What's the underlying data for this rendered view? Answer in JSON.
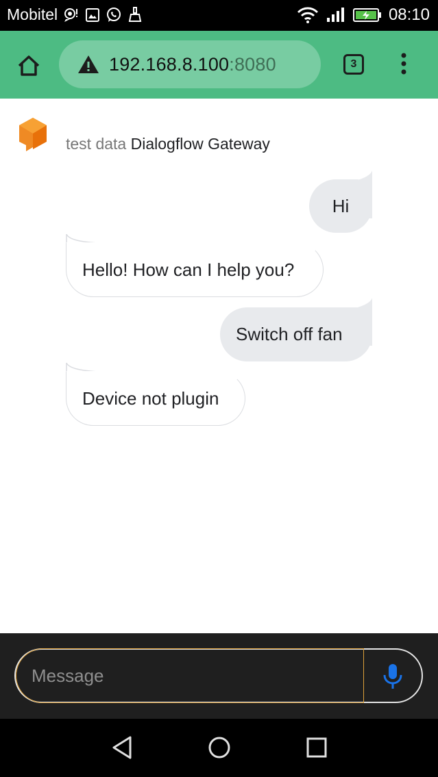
{
  "status_bar": {
    "carrier": "Mobitel",
    "time": "08:10",
    "icons": [
      "notification-icon",
      "gallery-icon",
      "whatsapp-icon",
      "clean-icon",
      "wifi-icon",
      "signal-icon",
      "battery-charging-icon"
    ]
  },
  "browser": {
    "url_host": "192.168.8.100",
    "url_port": ":8080",
    "tab_count": "3",
    "icons": [
      "home-icon",
      "warning-icon",
      "tabs-icon",
      "more-vert-icon"
    ],
    "theme_color": "#4dbb83"
  },
  "chat": {
    "title_prefix": "test data",
    "title": "Dialogflow Gateway",
    "messages": [
      {
        "from": "user",
        "text": "Hi"
      },
      {
        "from": "bot",
        "text": "Hello! How can I help you?"
      },
      {
        "from": "user",
        "text": "Switch off fan"
      },
      {
        "from": "bot",
        "text": "Device not plugin"
      }
    ]
  },
  "composer": {
    "placeholder": "Message",
    "mic_color": "#1a73e8"
  },
  "nav_bar": {
    "icons": [
      "back-icon",
      "home-circle-icon",
      "recents-icon"
    ]
  }
}
